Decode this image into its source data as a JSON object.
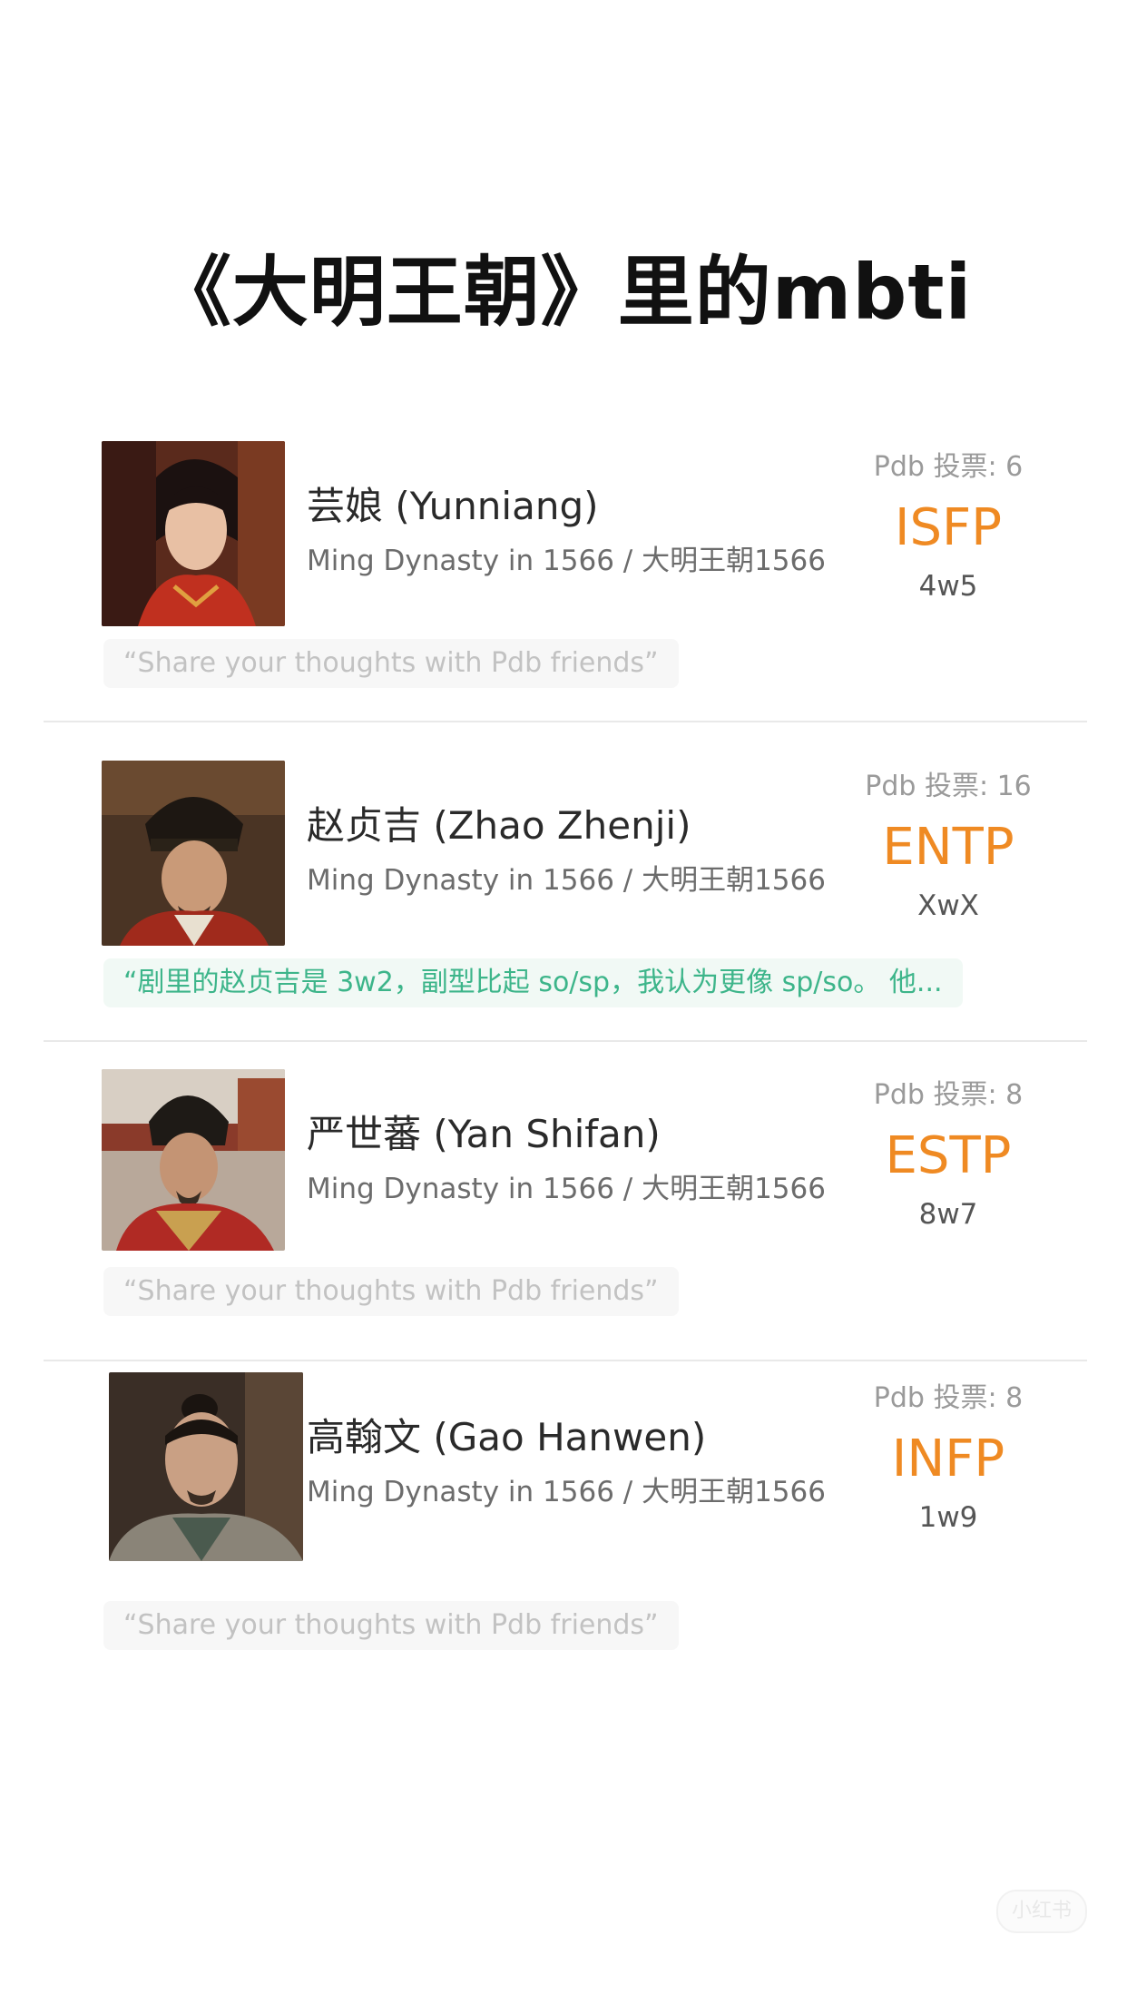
{
  "title": "《大明王朝》里的mbti",
  "characters": [
    {
      "name": "芸娘 (Yunniang)",
      "source": "Ming Dynasty in 1566 / 大明王朝1566",
      "votes": "Pdb 投票: 6",
      "type": "ISFP",
      "enneagram": "4w5",
      "comment": "“Share your thoughts with Pdb friends”",
      "comment_filled": false
    },
    {
      "name": "赵贞吉 (Zhao Zhenji)",
      "source": "Ming Dynasty in 1566 / 大明王朝1566",
      "votes": "Pdb 投票: 16",
      "type": "ENTP",
      "enneagram": "XwX",
      "comment": "“剧里的赵贞吉是 3w2，副型比起 so/sp，我认为更像 sp/so。 他...",
      "comment_filled": true
    },
    {
      "name": "严世蕃 (Yan Shifan)",
      "source": "Ming Dynasty in 1566 / 大明王朝1566",
      "votes": "Pdb 投票: 8",
      "type": "ESTP",
      "enneagram": "8w7",
      "comment": "“Share your thoughts with Pdb friends”",
      "comment_filled": false
    },
    {
      "name": "高翰文 (Gao Hanwen)",
      "source": "Ming Dynasty in 1566 / 大明王朝1566",
      "votes": "Pdb 投票: 8",
      "type": "INFP",
      "enneagram": "1w9",
      "comment": "“Share your thoughts with Pdb friends”",
      "comment_filled": false
    }
  ],
  "colors": {
    "mbti_accent": "#ef8a23",
    "comment_highlight": "#3db58a"
  },
  "icons": {
    "avatars": [
      "portrait-yunniang-icon",
      "portrait-zhao-zhenji-icon",
      "portrait-yan-shifan-icon",
      "portrait-gao-hanwen-icon"
    ]
  },
  "watermark": "小红书"
}
